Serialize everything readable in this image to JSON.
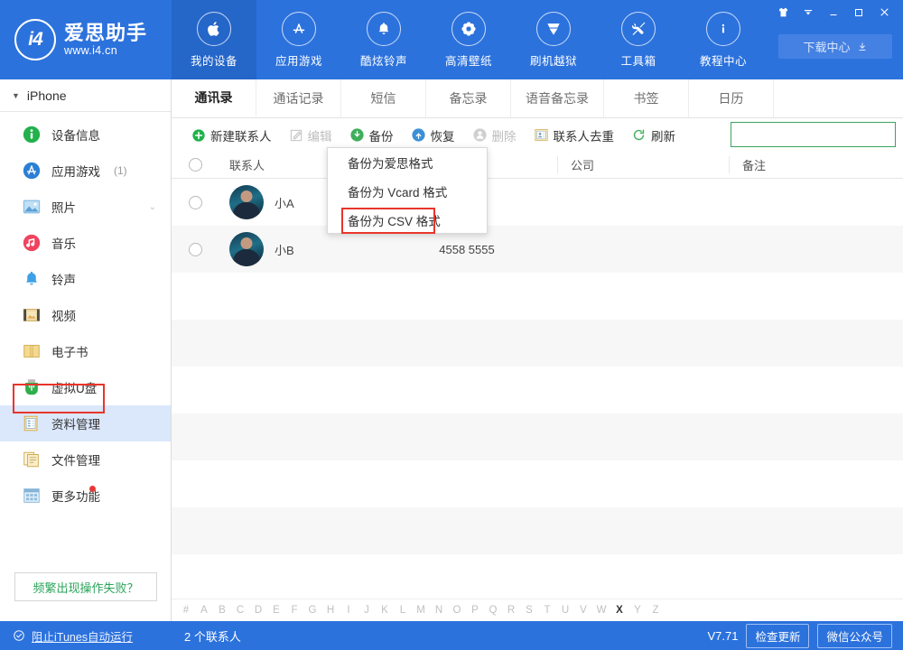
{
  "brand": {
    "name_cn": "爱思助手",
    "url": "www.i4.cn",
    "logo_text": "i4"
  },
  "topnav": [
    {
      "label": "我的设备",
      "icon": "apple-icon",
      "active": true
    },
    {
      "label": "应用游戏",
      "icon": "appstore-icon",
      "active": false
    },
    {
      "label": "酷炫铃声",
      "icon": "bell-icon",
      "active": false
    },
    {
      "label": "高清壁纸",
      "icon": "flower-icon",
      "active": false
    },
    {
      "label": "刷机越狱",
      "icon": "box-icon",
      "active": false
    },
    {
      "label": "工具箱",
      "icon": "tools-icon",
      "active": false
    },
    {
      "label": "教程中心",
      "icon": "info-icon",
      "active": false
    }
  ],
  "window": {
    "skin_icon": "shirt-icon",
    "menu_icon": "chevron-down-icon",
    "minimize_icon": "minimize-icon",
    "maximize_icon": "maximize-icon",
    "close_icon": "close-icon",
    "download_center": "下载中心"
  },
  "sidebar": {
    "device": "iPhone",
    "items": [
      {
        "label": "设备信息",
        "icon": "info-circle-icon",
        "count": "",
        "chevron": false,
        "selected": false,
        "dot": false
      },
      {
        "label": "应用游戏",
        "icon": "appstore-icon",
        "count": "(1)",
        "chevron": false,
        "selected": false,
        "dot": false
      },
      {
        "label": "照片",
        "icon": "photo-icon",
        "count": "",
        "chevron": true,
        "selected": false,
        "dot": false
      },
      {
        "label": "音乐",
        "icon": "music-icon",
        "count": "",
        "chevron": false,
        "selected": false,
        "dot": false
      },
      {
        "label": "铃声",
        "icon": "bell-icon",
        "count": "",
        "chevron": false,
        "selected": false,
        "dot": false
      },
      {
        "label": "视频",
        "icon": "video-icon",
        "count": "",
        "chevron": false,
        "selected": false,
        "dot": false
      },
      {
        "label": "电子书",
        "icon": "book-icon",
        "count": "",
        "chevron": false,
        "selected": false,
        "dot": false
      },
      {
        "label": "虚拟U盘",
        "icon": "usb-icon",
        "count": "",
        "chevron": false,
        "selected": false,
        "dot": false
      },
      {
        "label": "资料管理",
        "icon": "data-icon",
        "count": "",
        "chevron": false,
        "selected": true,
        "dot": false
      },
      {
        "label": "文件管理",
        "icon": "file-icon",
        "count": "",
        "chevron": false,
        "selected": false,
        "dot": false
      },
      {
        "label": "更多功能",
        "icon": "grid-icon",
        "count": "",
        "chevron": false,
        "selected": false,
        "dot": true
      }
    ],
    "help_button": "频繁出现操作失败？"
  },
  "tabs": [
    {
      "label": "通讯录",
      "active": true
    },
    {
      "label": "通话记录",
      "active": false
    },
    {
      "label": "短信",
      "active": false
    },
    {
      "label": "备忘录",
      "active": false
    },
    {
      "label": "语音备忘录",
      "active": false
    },
    {
      "label": "书签",
      "active": false
    },
    {
      "label": "日历",
      "active": false
    }
  ],
  "toolbar": {
    "buttons": [
      {
        "label": "新建联系人",
        "icon": "plus-circle-icon",
        "disabled": false
      },
      {
        "label": "编辑",
        "icon": "edit-icon",
        "disabled": true
      },
      {
        "label": "备份",
        "icon": "backup-icon",
        "disabled": false
      },
      {
        "label": "恢复",
        "icon": "restore-icon",
        "disabled": false
      },
      {
        "label": "删除",
        "icon": "delete-icon",
        "disabled": true
      },
      {
        "label": "联系人去重",
        "icon": "dedupe-icon",
        "disabled": false
      },
      {
        "label": "刷新",
        "icon": "refresh-icon",
        "disabled": false
      }
    ],
    "search_placeholder": "",
    "search_value": "",
    "search_icon": "search-icon"
  },
  "backup_menu": {
    "items": [
      {
        "label": "备份为爱思格式",
        "highlighted": false
      },
      {
        "label": "备份为 Vcard 格式",
        "highlighted": false
      },
      {
        "label": "备份为 CSV 格式",
        "highlighted": true
      }
    ]
  },
  "table": {
    "headers": {
      "name": "联系人",
      "phone": "",
      "company": "公司",
      "note": "备注"
    },
    "rows": [
      {
        "name": "小A",
        "phone": "",
        "company": "",
        "note": "",
        "avatar": "contact-avatar"
      },
      {
        "name": "小B",
        "phone": "4558 5555",
        "company": "",
        "note": "",
        "avatar": "contact-avatar"
      }
    ],
    "empty_rows": 8
  },
  "alphabet": {
    "letters": [
      "#",
      "A",
      "B",
      "C",
      "D",
      "E",
      "F",
      "G",
      "H",
      "I",
      "J",
      "K",
      "L",
      "M",
      "N",
      "O",
      "P",
      "Q",
      "R",
      "S",
      "T",
      "U",
      "V",
      "W",
      "X",
      "Y",
      "Z"
    ],
    "active": "X"
  },
  "statusbar": {
    "itunes_block": "阻止iTunes自动运行",
    "itunes_icon": "check-circle-icon",
    "contact_count": "2 个联系人",
    "version": "V7.71",
    "check_update": "检查更新",
    "wechat": "微信公众号"
  },
  "colors": {
    "brand_blue": "#2c72dd",
    "accent_green": "#2aa55a",
    "highlight_red": "#e8352c",
    "selected_row": "#dbe7fb"
  }
}
